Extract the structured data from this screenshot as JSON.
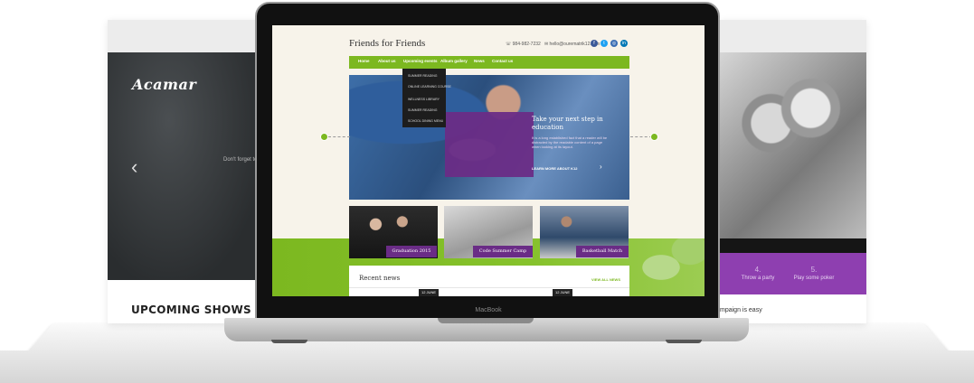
{
  "left_card": {
    "logo": "Acamar",
    "arrow": "‹",
    "snippet": "Don't forget to",
    "heading": "UPCOMING SHOWS"
  },
  "right_card": {
    "steps": [
      {
        "num": "4.",
        "label": "Throw a party"
      },
      {
        "num": "5.",
        "label": "Play some poker"
      }
    ],
    "caption": "mpaign is easy"
  },
  "laptop": {
    "brand": "MacBook"
  },
  "site": {
    "title": "Friends for Friends",
    "phone": "984-982-7232",
    "email": "hello@ourematrik12.com",
    "social": [
      {
        "icon": "facebook-icon",
        "glyph": "f",
        "color": "#3b5998"
      },
      {
        "icon": "twitter-icon",
        "glyph": "t",
        "color": "#1da1f2"
      },
      {
        "icon": "instagram-icon",
        "glyph": "◎",
        "color": "#3a6db3"
      },
      {
        "icon": "linkedin-icon",
        "glyph": "in",
        "color": "#0077b5"
      }
    ],
    "nav": [
      "Home",
      "About us",
      "Upcoming events",
      "Album gallery",
      "News",
      "Contact us"
    ],
    "dropdown": [
      "SUMMER READING",
      "ONLINE LEARNING COURSE",
      "WELLNESS LIBRARY",
      "SUMMER READING",
      "SCHOOL DINING MENU"
    ],
    "hero": {
      "title": "Take your next step in education",
      "text": "It is a long established fact that a reader will be distracted by the readable content of a page when looking at its layout.",
      "link": "LEARN MORE ABOUT K12",
      "arrow": "›"
    },
    "thumbs": [
      "Graduation 2015",
      "Code Summer Camp",
      "Basketball Match"
    ],
    "news": {
      "title": "Recent news",
      "view_all": "VIEW ALL NEWS",
      "badges": [
        "12 JUNE",
        "12 JUNE"
      ]
    }
  },
  "colors": {
    "green": "#7cb820",
    "purple": "#6a2c86",
    "right_purple": "#8e3fb0"
  }
}
